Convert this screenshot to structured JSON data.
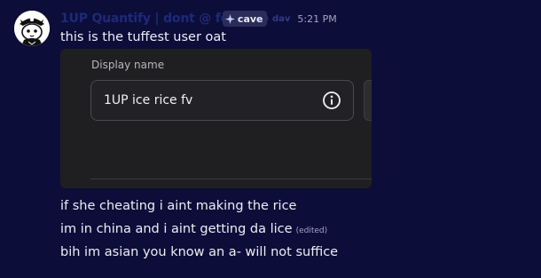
{
  "message": {
    "username": "1UP Quantify | dont @ for help",
    "tag_label": "cave",
    "tag_ghost": " dav",
    "timestamp": "5:21 PM",
    "lines": [
      "this is the tuffest user oat",
      "if she cheating i aint making the rice",
      "im in china and i aint getting da lice",
      "bih im asian you know an a- will not suffice"
    ],
    "edited_label": "(edited)"
  },
  "embed": {
    "field_label": "Display name",
    "field_value": "1UP ice rice fv"
  },
  "colors": {
    "background": "#0c0d39",
    "username": "#1d2a78",
    "embed_bg": "#1f1f22"
  },
  "icons": {
    "avatar": "pirate-cat-avatar",
    "tag": "sparkle-icon",
    "info": "info-icon"
  }
}
